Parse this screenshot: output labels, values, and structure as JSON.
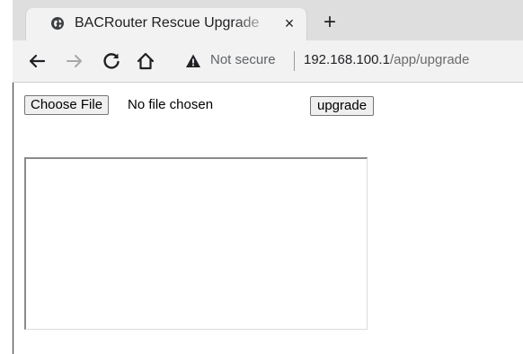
{
  "browser": {
    "tab": {
      "title": "BACRouter Rescue Upgrade",
      "close_glyph": "×",
      "favicon": "globe-icon"
    },
    "new_tab_glyph": "+",
    "toolbar": {
      "back_icon": "arrow-left-icon",
      "forward_icon": "arrow-right-icon",
      "reload_icon": "reload-icon",
      "home_icon": "home-icon"
    },
    "omnibox": {
      "security_label": "Not secure",
      "security_icon": "warning-icon",
      "url_host": "192.168.100.1",
      "url_path": "/app/upgrade"
    }
  },
  "page": {
    "file_input": {
      "button_label": "Choose File",
      "status": "No file chosen"
    },
    "upgrade_button": {
      "label": "upgrade"
    },
    "log_textarea": {
      "value": ""
    }
  }
}
